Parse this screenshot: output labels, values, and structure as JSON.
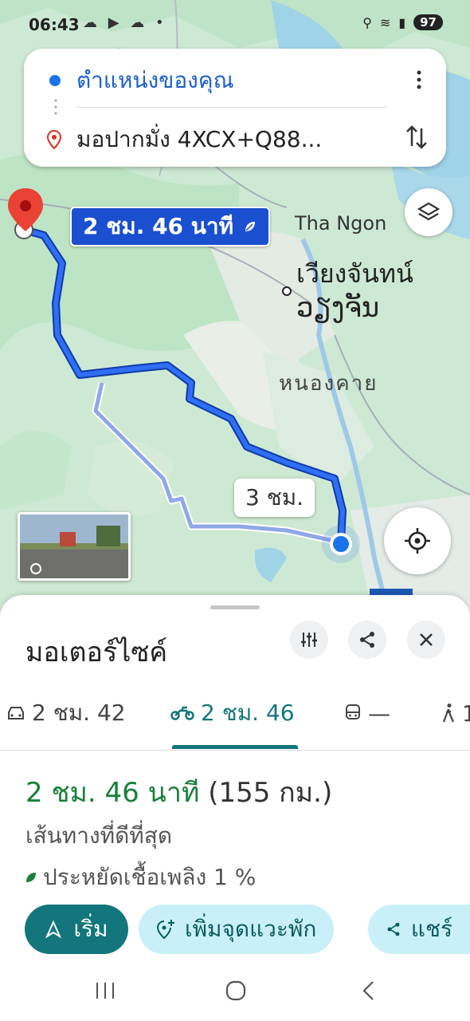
{
  "status_bar": {
    "time": "06:43",
    "battery": "97"
  },
  "route_card": {
    "origin": "ตำแหน่งของคุณ",
    "destination": "มอปากมั่ง 4XCX+Q88..."
  },
  "map": {
    "eta_badge": "2 ชม. 46 นาที",
    "alt_route_badge": "3 ชม.",
    "labels": {
      "tha_ngon": "Tha Ngon",
      "vientiane_th": "เวียงจันทน์",
      "vientiane_lao": "ວຽງຈັນ",
      "nong_khai": "หนองคาย"
    }
  },
  "sheet": {
    "title": "มอเตอร์ไซค์",
    "tabs": [
      {
        "label": "2 ชม. 42",
        "icon": "car-icon"
      },
      {
        "label": "2 ชม. 46",
        "icon": "motorcycle-icon"
      },
      {
        "label": "—",
        "icon": "transit-icon"
      },
      {
        "label": "1",
        "icon": "walk-icon"
      }
    ],
    "duration": "2 ชม. 46 นาที",
    "distance": "(155 กม.)",
    "route_note": "เส้นทางที่ดีที่สุด",
    "eco_note": "ประหยัดเชื้อเพลิง 1 %",
    "actions": {
      "start": "เริ่ม",
      "add_stop": "เพิ่มจุดแวะพัก",
      "share": "แชร์"
    }
  },
  "colors": {
    "primary_route": "#1a4fd0",
    "alt_route": "#8fa7e8",
    "accent_teal": "#12767c",
    "duration_green": "#188038"
  }
}
